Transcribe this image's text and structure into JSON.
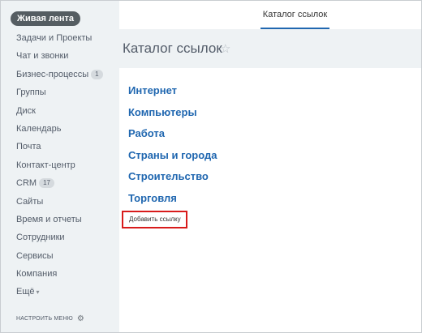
{
  "sidebar": {
    "feed_label": "Живая лента",
    "items": [
      {
        "label": "Задачи и Проекты"
      },
      {
        "label": "Чат и звонки"
      },
      {
        "label": "Бизнес-процессы",
        "counter": "1"
      },
      {
        "label": "Группы"
      },
      {
        "label": "Диск"
      },
      {
        "label": "Календарь"
      },
      {
        "label": "Почта"
      },
      {
        "label": "Контакт-центр"
      },
      {
        "label": "CRM",
        "counter": "17"
      },
      {
        "label": "Сайты"
      },
      {
        "label": "Время и отчеты"
      },
      {
        "label": "Сотрудники"
      },
      {
        "label": "Сервисы"
      },
      {
        "label": "Компания"
      },
      {
        "label": "Ещё"
      }
    ],
    "settings_label": "НАСТРОИТЬ МЕНЮ"
  },
  "topbar": {
    "tab_label": "Каталог ссылок"
  },
  "page": {
    "title": "Каталог ссылок"
  },
  "catalog": {
    "categories": [
      {
        "label": "Интернет"
      },
      {
        "label": "Компьютеры"
      },
      {
        "label": "Работа"
      },
      {
        "label": "Страны и города"
      },
      {
        "label": "Строительство"
      },
      {
        "label": "Торговля"
      }
    ],
    "add_link_label": "Добавить ссылку"
  },
  "colors": {
    "accent": "#2067b0",
    "highlight": "#d81b1b",
    "sidebar_bg": "#eef2f4"
  }
}
